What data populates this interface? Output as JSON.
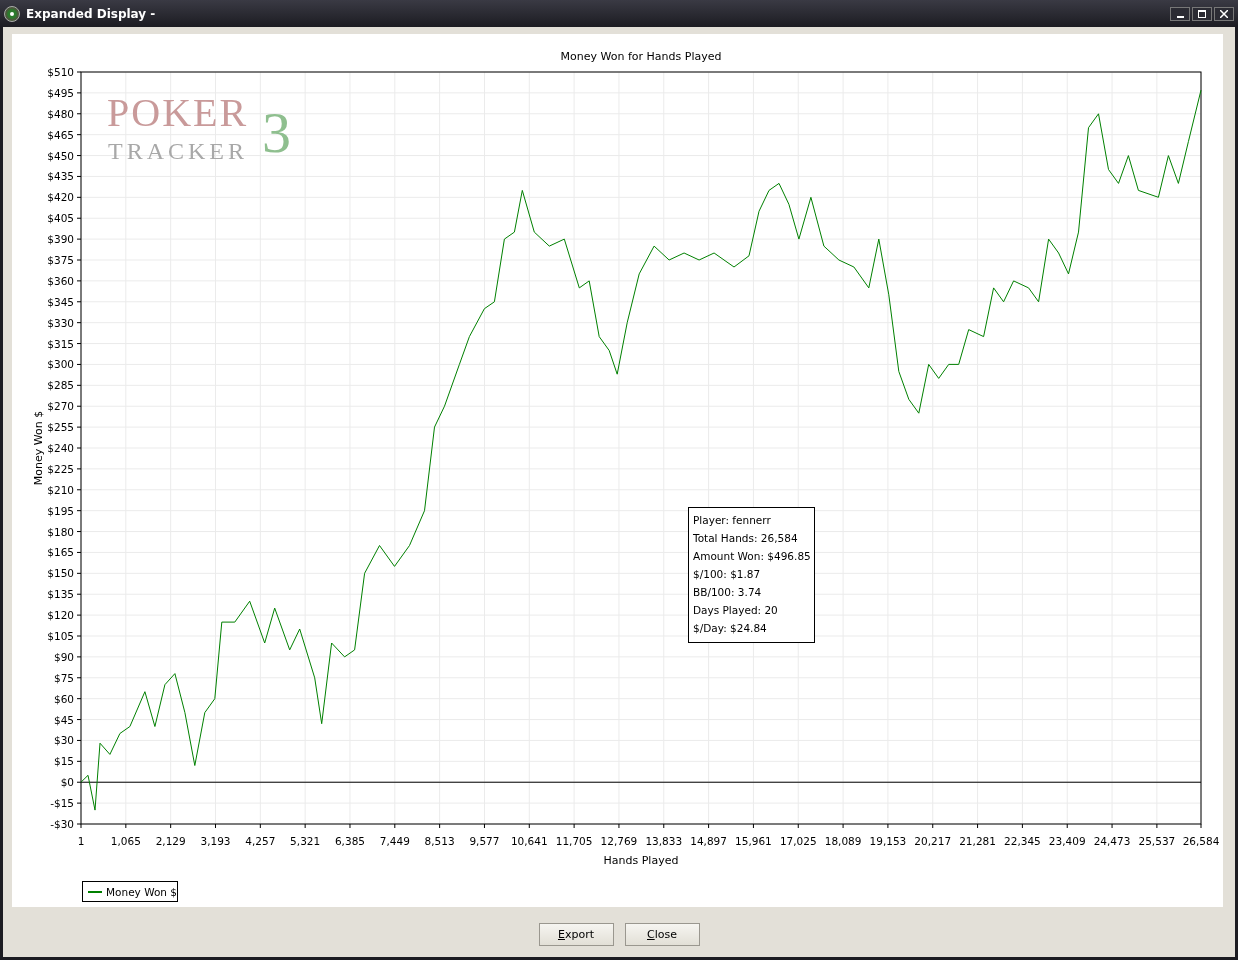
{
  "window": {
    "title": "Expanded Display -"
  },
  "chart": {
    "logo": {
      "line_1": "POKER",
      "line_2": "TRACKER",
      "mark": "3"
    },
    "info_box": {
      "lines": [
        "Player: fennerr",
        "Total Hands: 26,584",
        "Amount Won: $496.85",
        "$/100: $1.87",
        "BB/100: 3.74",
        "Days Played: 20",
        "$/Day: $24.84"
      ]
    },
    "chart_data": {
      "type": "line",
      "title": "Money Won for Hands Played",
      "xlabel": "Hands Played",
      "ylabel": "Money Won $",
      "x": [
        1,
        167,
        333,
        451,
        688,
        925,
        1162,
        1518,
        1755,
        1992,
        2229,
        2466,
        2703,
        2940,
        3177,
        3343,
        3651,
        4006,
        4362,
        4599,
        4954,
        5191,
        5547,
        5713,
        5950,
        6258,
        6495,
        6732,
        7087,
        7443,
        7798,
        8154,
        8391,
        8628,
        8983,
        9220,
        9576,
        9813,
        10050,
        10287,
        10476,
        10761,
        11116,
        11472,
        11827,
        12064,
        12301,
        12538,
        12728,
        12965,
        13249,
        13604,
        13960,
        14315,
        14671,
        15027,
        15501,
        15856,
        16093,
        16330,
        16567,
        16804,
        17041,
        17325,
        17634,
        17989,
        18345,
        18700,
        18937,
        19174,
        19411,
        19648,
        19885,
        20122,
        20359,
        20596,
        20833,
        21070,
        21425,
        21662,
        21899,
        22136,
        22492,
        22729,
        22966,
        23203,
        23440,
        23677,
        23914,
        24151,
        24388,
        24625,
        24862,
        25099,
        25573,
        25810,
        26047,
        26284,
        26584
      ],
      "series": [
        {
          "name": "Money Won $",
          "color": "#008000",
          "values": [
            0,
            5,
            -20,
            28,
            20,
            35,
            40,
            65,
            40,
            70,
            78,
            50,
            12,
            50,
            60,
            115,
            115,
            130,
            100,
            125,
            95,
            110,
            75,
            42,
            100,
            90,
            95,
            150,
            170,
            155,
            170,
            195,
            255,
            270,
            300,
            320,
            340,
            345,
            390,
            395,
            425,
            395,
            385,
            390,
            355,
            360,
            320,
            310,
            293,
            330,
            365,
            385,
            375,
            380,
            375,
            380,
            370,
            378,
            410,
            425,
            430,
            415,
            390,
            420,
            385,
            375,
            370,
            355,
            390,
            350,
            295,
            275,
            265,
            300,
            290,
            300,
            300,
            325,
            320,
            355,
            345,
            360,
            355,
            345,
            390,
            380,
            365,
            395,
            470,
            480,
            440,
            430,
            450,
            425,
            420,
            450,
            430,
            460,
            497
          ]
        }
      ],
      "grid": true,
      "xlim": [
        1,
        26584
      ],
      "ylim": [
        -30,
        510
      ],
      "xticks": [
        1,
        {
          "value": 1065,
          "label": "1,065"
        },
        {
          "value": 2129,
          "label": "2,129"
        },
        {
          "value": 3193,
          "label": "3,193"
        },
        {
          "value": 4257,
          "label": "4,257"
        },
        {
          "value": 5321,
          "label": "5,321"
        },
        {
          "value": 6385,
          "label": "6,385"
        },
        {
          "value": 7449,
          "label": "7,449"
        },
        {
          "value": 8513,
          "label": "8,513"
        },
        {
          "value": 9577,
          "label": "9,577"
        },
        {
          "value": 10641,
          "label": "10,641"
        },
        {
          "value": 11705,
          "label": "11,705"
        },
        {
          "value": 12769,
          "label": "12,769"
        },
        {
          "value": 13833,
          "label": "13,833"
        },
        {
          "value": 14897,
          "label": "14,897"
        },
        {
          "value": 15961,
          "label": "15,961"
        },
        {
          "value": 17025,
          "label": "17,025"
        },
        {
          "value": 18089,
          "label": "18,089"
        },
        {
          "value": 19153,
          "label": "19,153"
        },
        {
          "value": 20217,
          "label": "20,217"
        },
        {
          "value": 21281,
          "label": "21,281"
        },
        {
          "value": 22345,
          "label": "22,345"
        },
        {
          "value": 23409,
          "label": "23,409"
        },
        {
          "value": 24473,
          "label": "24,473"
        },
        {
          "value": 25537,
          "label": "25,537"
        },
        {
          "value": 26584,
          "label": "26,584"
        }
      ],
      "yticks": [
        {
          "value": 510,
          "label": "$510"
        },
        {
          "value": 495,
          "label": "$495"
        },
        {
          "value": 480,
          "label": "$480"
        },
        {
          "value": 465,
          "label": "$465"
        },
        {
          "value": 450,
          "label": "$450"
        },
        {
          "value": 435,
          "label": "$435"
        },
        {
          "value": 420,
          "label": "$420"
        },
        {
          "value": 405,
          "label": "$405"
        },
        {
          "value": 390,
          "label": "$390"
        },
        {
          "value": 375,
          "label": "$375"
        },
        {
          "value": 360,
          "label": "$360"
        },
        {
          "value": 345,
          "label": "$345"
        },
        {
          "value": 330,
          "label": "$330"
        },
        {
          "value": 315,
          "label": "$315"
        },
        {
          "value": 300,
          "label": "$300"
        },
        {
          "value": 285,
          "label": "$285"
        },
        {
          "value": 270,
          "label": "$270"
        },
        {
          "value": 255,
          "label": "$255"
        },
        {
          "value": 240,
          "label": "$240"
        },
        {
          "value": 225,
          "label": "$225"
        },
        {
          "value": 210,
          "label": "$210"
        },
        {
          "value": 195,
          "label": "$195"
        },
        {
          "value": 180,
          "label": "$180"
        },
        {
          "value": 165,
          "label": "$165"
        },
        {
          "value": 150,
          "label": "$150"
        },
        {
          "value": 135,
          "label": "$135"
        },
        {
          "value": 120,
          "label": "$120"
        },
        {
          "value": 105,
          "label": "$105"
        },
        {
          "value": 90,
          "label": "$90"
        },
        {
          "value": 75,
          "label": "$75"
        },
        {
          "value": 60,
          "label": "$60"
        },
        {
          "value": 45,
          "label": "$45"
        },
        {
          "value": 30,
          "label": "$30"
        },
        {
          "value": 15,
          "label": "$15"
        },
        {
          "value": 0,
          "label": "$0"
        },
        {
          "value": -15,
          "label": "-$15"
        },
        {
          "value": -30,
          "label": "-$30"
        }
      ]
    }
  },
  "buttons": [
    {
      "label": "Export"
    },
    {
      "label": "Close"
    }
  ]
}
